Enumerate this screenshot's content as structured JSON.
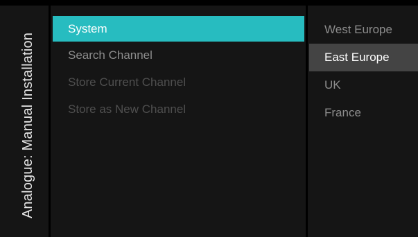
{
  "title": "Analogue: Manual Installation",
  "menu": {
    "items": [
      {
        "label": "System",
        "state": "selected"
      },
      {
        "label": "Search Channel",
        "state": "normal"
      },
      {
        "label": "Store Current Channel",
        "state": "disabled"
      },
      {
        "label": "Store as New Channel",
        "state": "disabled"
      }
    ]
  },
  "options": {
    "items": [
      {
        "label": "West Europe",
        "state": "normal"
      },
      {
        "label": "East Europe",
        "state": "highlighted"
      },
      {
        "label": "UK",
        "state": "normal"
      },
      {
        "label": "France",
        "state": "normal"
      }
    ]
  },
  "colors": {
    "accent": "#27bcc0",
    "highlight": "#444444",
    "panel": "#151515",
    "background": "#000000"
  }
}
